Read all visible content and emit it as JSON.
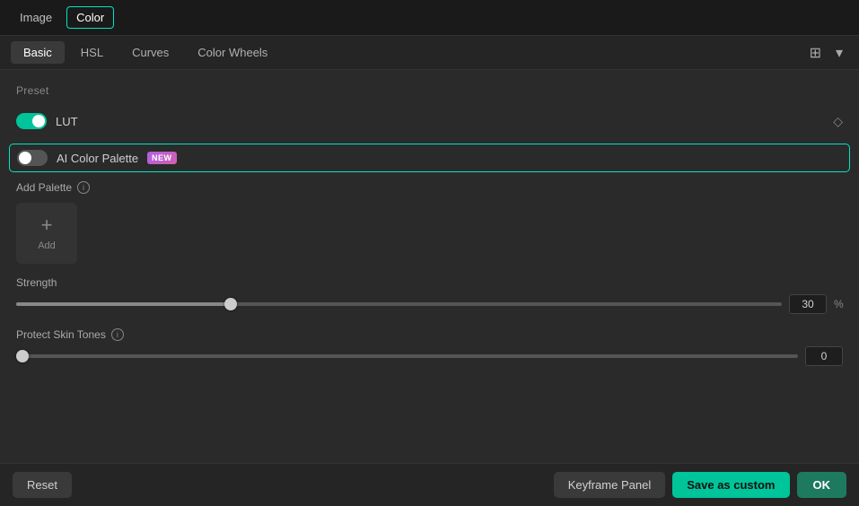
{
  "topNav": {
    "image_label": "Image",
    "color_label": "Color",
    "active": "color"
  },
  "subNav": {
    "tabs": [
      {
        "id": "basic",
        "label": "Basic",
        "active": true
      },
      {
        "id": "hsl",
        "label": "HSL",
        "active": false
      },
      {
        "id": "curves",
        "label": "Curves",
        "active": false
      },
      {
        "id": "color-wheels",
        "label": "Color Wheels",
        "active": false
      }
    ],
    "split_icon": "⊞",
    "chevron_icon": "▾"
  },
  "preset": {
    "section_label": "Preset",
    "lut": {
      "label": "LUT",
      "enabled": true,
      "diamond_icon": "◇"
    },
    "ai_palette": {
      "label": "AI Color Palette",
      "badge": "NEW",
      "enabled": false,
      "highlighted": true
    }
  },
  "addPalette": {
    "label": "Add Palette",
    "info_icon": "i",
    "add_button_label": "Add"
  },
  "strength": {
    "label": "Strength",
    "value": 30,
    "unit": "%",
    "fill_percent": 28
  },
  "protectSkinTones": {
    "label": "Protect Skin Tones",
    "info_icon": "i",
    "value": 0,
    "fill_percent": 0
  },
  "bottomBar": {
    "reset_label": "Reset",
    "keyframe_label": "Keyframe Panel",
    "save_custom_label": "Save as custom",
    "ok_label": "OK"
  }
}
